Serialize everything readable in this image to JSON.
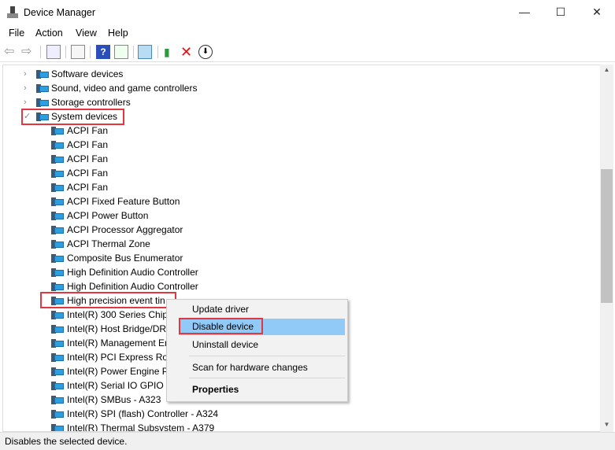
{
  "window": {
    "title": "Device Manager",
    "minimize": "—",
    "maximize": "☐",
    "close": "✕"
  },
  "menu": [
    "File",
    "Action",
    "View",
    "Help"
  ],
  "toolbar": [
    "back-icon",
    "forward-icon",
    "show-hide-console-tree-icon",
    "properties-icon",
    "help-icon",
    "run-icon",
    "scan-hardware-icon",
    "update-driver-icon",
    "uninstall-icon",
    "download-icon"
  ],
  "tree": {
    "categories": [
      {
        "label": "Software devices",
        "expanded": false
      },
      {
        "label": "Sound, video and game controllers",
        "expanded": false
      },
      {
        "label": "Storage controllers",
        "expanded": false
      },
      {
        "label": "System devices",
        "expanded": true
      }
    ],
    "devices": [
      "ACPI Fan",
      "ACPI Fan",
      "ACPI Fan",
      "ACPI Fan",
      "ACPI Fan",
      "ACPI Fixed Feature Button",
      "ACPI Power Button",
      "ACPI Processor Aggregator",
      "ACPI Thermal Zone",
      "Composite Bus Enumerator",
      "High Definition Audio Controller",
      "High Definition Audio Controller",
      "High precision event tin",
      "Intel(R) 300 Series Chips",
      "Intel(R) Host Bridge/DR/",
      "Intel(R) Management Er",
      "Intel(R) PCI Express Roo",
      "Intel(R) Power Engine Pl",
      "Intel(R) Serial IO GPIO H",
      "Intel(R) SMBus - A323",
      "Intel(R) SPI (flash) Controller - A324",
      "Intel(R) Thermal Subsystem - A379"
    ]
  },
  "context_menu": {
    "update": "Update driver",
    "disable": "Disable device",
    "uninstall": "Uninstall device",
    "scan": "Scan for hardware changes",
    "properties": "Properties"
  },
  "status": "Disables the selected device.",
  "colors": {
    "highlight_box": "#e0383e",
    "menu_hover": "#91c9f7"
  }
}
